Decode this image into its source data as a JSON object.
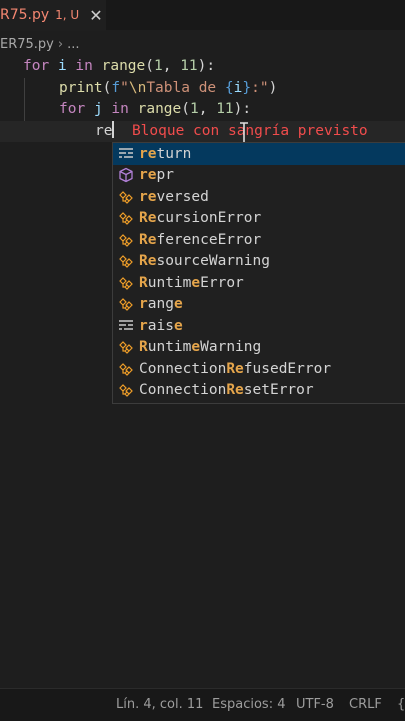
{
  "tab": {
    "title": "R75.py",
    "badge": "1, U",
    "close": "✕"
  },
  "breadcrumb": {
    "file": "ER75.py",
    "sep": "›",
    "more": "..."
  },
  "code": {
    "l1": {
      "for": "for",
      "i": "i",
      "in": "in",
      "range": "range",
      "open": "(",
      "a": "1",
      "comma": ", ",
      "b": "11",
      "close": "):"
    },
    "l2": {
      "print": "print",
      "open": "(",
      "f": "f",
      "q1": "\"",
      "esc": "\\n",
      "text": "Tabla de ",
      "brace_open": "{",
      "var": "i",
      "brace_close": "}",
      "colon": ":",
      "q2": "\"",
      "close": ")"
    },
    "l3": {
      "for": "for",
      "j": "j",
      "in": "in",
      "range": "range",
      "open": "(",
      "a": "1",
      "comma": ", ",
      "b": "11",
      "close": "):"
    },
    "l4": {
      "typed": "re",
      "hint": "Bloque con sangría previsto"
    }
  },
  "suggestions": [
    {
      "kind": "keyword",
      "match": "re",
      "rest": "turn"
    },
    {
      "kind": "function",
      "match": "re",
      "rest": "pr"
    },
    {
      "kind": "class",
      "match": "re",
      "rest": "versed"
    },
    {
      "kind": "class",
      "pre": "",
      "parts": [
        [
          "R",
          ""
        ],
        [
          "ec",
          ""
        ]
      ],
      "label": "RecursionError"
    },
    {
      "kind": "class",
      "label": "ReferenceError"
    },
    {
      "kind": "class",
      "label": "ResourceWarning"
    },
    {
      "kind": "class",
      "label": "RuntimeError"
    },
    {
      "kind": "class",
      "label": "range"
    },
    {
      "kind": "keyword",
      "label": "raise"
    },
    {
      "kind": "class",
      "label": "RuntimeWarning"
    },
    {
      "kind": "class",
      "label": "ConnectionRefusedError"
    },
    {
      "kind": "class",
      "label": "ConnectionResetError"
    }
  ],
  "suggest_labels": {
    "s0a": "re",
    "s0b": "turn",
    "s1a": "re",
    "s1b": "pr",
    "s2a": "re",
    "s2b": "versed",
    "s3a": "Re",
    "s3b": "cursionError",
    "s4a": "Re",
    "s4b": "ferenceError",
    "s5a": "Re",
    "s5b": "sourceWarning",
    "s6a": "R",
    "s6b": "untim",
    "s6c": "e",
    "s6d": "Error",
    "s7a": "r",
    "s7b": "ang",
    "s7c": "e",
    "s8a": "r",
    "s8b": "ais",
    "s8c": "e",
    "s9a": "R",
    "s9b": "untim",
    "s9c": "e",
    "s9d": "Warning",
    "s10a": "Connection",
    "s10b": "Re",
    "s10c": "fusedError",
    "s11a": "Connection",
    "s11b": "Re",
    "s11c": "setError"
  },
  "status": {
    "position": "Lín. 4, col. 11",
    "spaces": "Espacios: 4",
    "encoding": "UTF-8",
    "eol": "CRLF",
    "brace": "{"
  },
  "colors": {
    "editor_bg": "#1e1e1e",
    "keyword_blue": "#569cd6",
    "control_purple": "#c586c0",
    "function_yellow": "#dcdcaa",
    "number_green": "#b5cea8",
    "string_orange": "#ce9178",
    "match_highlight": "#e5a54b",
    "error_red": "#f14c4c",
    "tab_modified": "#f48771"
  }
}
